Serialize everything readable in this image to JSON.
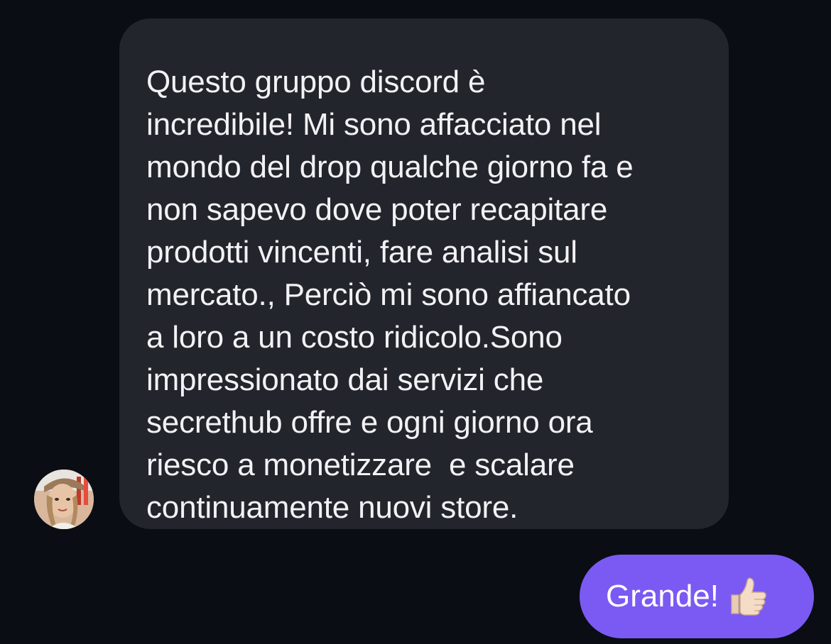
{
  "conversation": {
    "incoming": {
      "avatar_icon": "user-avatar",
      "text": "Questo gruppo discord è\nincredibile! Mi sono affacciato nel\nmondo del drop qualche giorno fa e\nnon sapevo dove poter recapitare\nprodotti vincenti, fare analisi sul\nmercato., Perciò mi sono affiancato\na loro a un costo ridicolo.Sono\nimpressionato dai servizi che\nsecrethub offre e ogni giorno ora\nriesco a monetizzare  e scalare\ncontinuamente nuovi store.",
      "bubble_color": "#23252c"
    },
    "outgoing": {
      "text": "Grande!",
      "emoji_icon": "thumbs-up-emoji",
      "bubble_color": "#7b5af3"
    }
  },
  "colors": {
    "background": "#0b0d14",
    "text": "#f2f2f5"
  }
}
